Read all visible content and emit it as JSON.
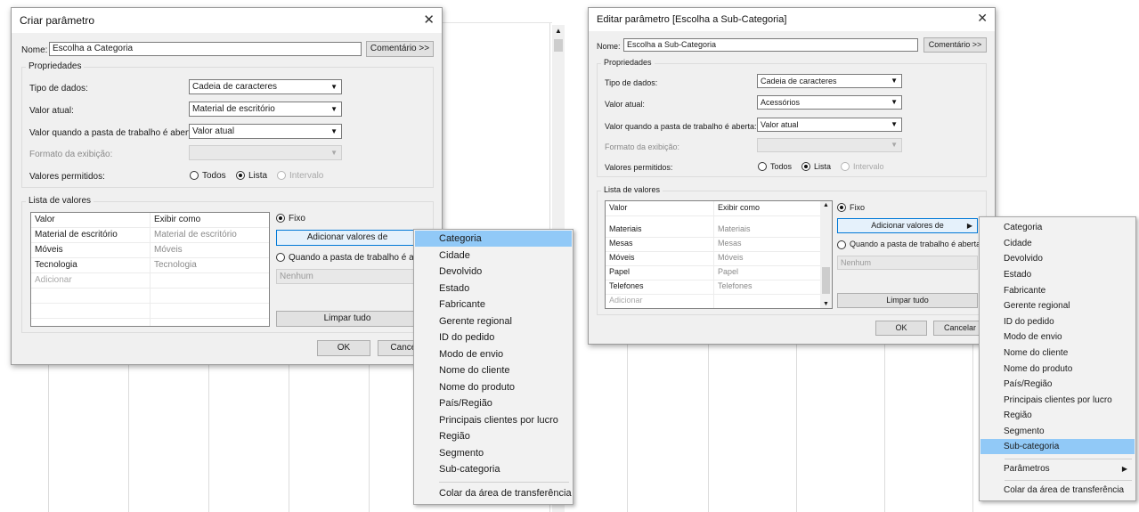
{
  "left_dialog": {
    "title": "Criar parâmetro",
    "name_label": "Nome:",
    "name_value": "Escolha a Categoria",
    "comment_button": "Comentário >>",
    "properties_group": "Propriedades",
    "data_type_label": "Tipo de dados:",
    "data_type_value": "Cadeia de caracteres",
    "current_value_label": "Valor atual:",
    "current_value": "Material de escritório",
    "open_value_label": "Valor quando a pasta de trabalho é aberta:",
    "open_value": "Valor atual",
    "display_format_label": "Formato da exibição:",
    "allowed_label": "Valores permitidos:",
    "allowed_all": "Todos",
    "allowed_list": "Lista",
    "allowed_range": "Intervalo",
    "list_group": "Lista de valores",
    "col_value": "Valor",
    "col_display": "Exibir como",
    "rows": [
      {
        "value": "Material de escritório",
        "display": "Material de escritório"
      },
      {
        "value": "Móveis",
        "display": "Móveis"
      },
      {
        "value": "Tecnologia",
        "display": "Tecnologia"
      }
    ],
    "add_row": "Adicionar",
    "fixed_radio": "Fixo",
    "add_values_button": "Adicionar valores de",
    "when_open_radio": "Quando a pasta de trabalho é aber",
    "none_combo": "Nenhum",
    "clear_button": "Limpar tudo",
    "ok_button": "OK",
    "cancel_button": "Cancel"
  },
  "left_menu": {
    "items": [
      "Categoria",
      "Cidade",
      "Devolvido",
      "Estado",
      "Fabricante",
      "Gerente regional",
      "ID do pedido",
      "Modo de envio",
      "Nome do cliente",
      "Nome do produto",
      "País/Região",
      "Principais clientes por lucro",
      "Região",
      "Segmento",
      "Sub-categoria"
    ],
    "selected": "Categoria",
    "paste": "Colar da área de transferência"
  },
  "right_dialog": {
    "title": "Editar parâmetro [Escolha a Sub-Categoria]",
    "name_label": "Nome:",
    "name_value": "Escolha a Sub-Categoria",
    "comment_button": "Comentário >>",
    "properties_group": "Propriedades",
    "data_type_label": "Tipo de dados:",
    "data_type_value": "Cadeia de caracteres",
    "current_value_label": "Valor atual:",
    "current_value": "Acessórios",
    "open_value_label": "Valor quando a pasta de trabalho é aberta:",
    "open_value": "Valor atual",
    "display_format_label": "Formato da exibição:",
    "allowed_label": "Valores permitidos:",
    "allowed_all": "Todos",
    "allowed_list": "Lista",
    "allowed_range": "Intervalo",
    "list_group": "Lista de valores",
    "col_value": "Valor",
    "col_display": "Exibir como",
    "rows": [
      {
        "value": "Materiais",
        "display": "Materiais"
      },
      {
        "value": "Mesas",
        "display": "Mesas"
      },
      {
        "value": "Móveis",
        "display": "Móveis"
      },
      {
        "value": "Papel",
        "display": "Papel"
      },
      {
        "value": "Telefones",
        "display": "Telefones"
      }
    ],
    "add_row": "Adicionar",
    "fixed_radio": "Fixo",
    "add_values_button": "Adicionar valores de",
    "when_open_radio": "Quando a pasta de trabalho é aberta",
    "none_combo": "Nenhum",
    "clear_button": "Limpar tudo",
    "ok_button": "OK",
    "cancel_button": "Cancelar"
  },
  "right_menu": {
    "items": [
      "Categoria",
      "Cidade",
      "Devolvido",
      "Estado",
      "Fabricante",
      "Gerente regional",
      "ID do pedido",
      "Modo de envio",
      "Nome do cliente",
      "Nome do produto",
      "País/Região",
      "Principais clientes por lucro",
      "Região",
      "Segmento",
      "Sub-categoria"
    ],
    "selected": "Sub-categoria",
    "parameters": "Parâmetros",
    "paste": "Colar da área de transferência"
  },
  "icons": {
    "close": "close-icon",
    "dropdown": "chevron-down-icon",
    "submenu": "chevron-right-icon",
    "scroll_up": "scroll-up-icon",
    "scroll_down": "scroll-down-icon"
  },
  "colors": {
    "selection": "#91c9f7",
    "focus_border": "#0078d7",
    "dialog_bg": "#f0f0f0"
  }
}
